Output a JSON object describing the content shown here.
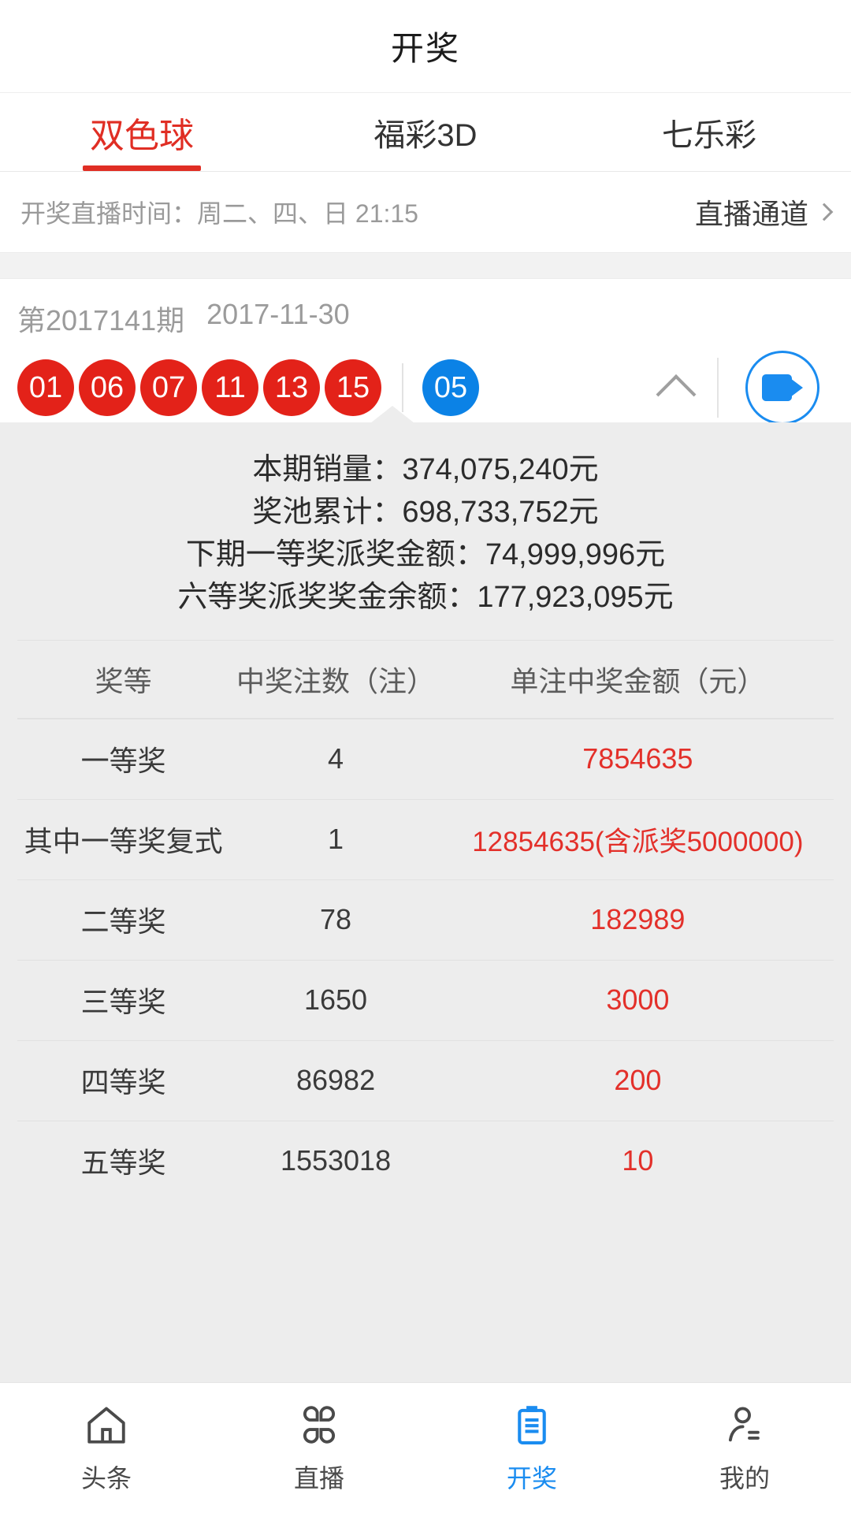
{
  "header": {
    "title": "开奖"
  },
  "tabs": [
    {
      "label": "双色球",
      "active": true
    },
    {
      "label": "福彩3D",
      "active": false
    },
    {
      "label": "七乐彩",
      "active": false
    }
  ],
  "live_bar": {
    "schedule_text": "开奖直播时间：周二、四、日 21:15",
    "channel_label": "直播通道",
    "chevron_icon": "chevron-right-icon"
  },
  "draw": {
    "issue_label": "第2017141期",
    "date": "2017-11-30",
    "red_balls": [
      "01",
      "06",
      "07",
      "11",
      "13",
      "15"
    ],
    "blue_balls": [
      "05"
    ],
    "collapse_icon": "chevron-up-icon",
    "video_icon": "video-camera-icon"
  },
  "stats": [
    "本期销量：374,075,240元",
    "奖池累计：698,733,752元",
    "下期一等奖派奖金额：74,999,996元",
    "六等奖派奖奖金余额：177,923,095元"
  ],
  "prize_table": {
    "columns": [
      "奖等",
      "中奖注数（注）",
      "单注中奖金额（元）"
    ],
    "rows": [
      {
        "level": "一等奖",
        "count": "4",
        "amount": "7854635"
      },
      {
        "level": "其中一等奖复式",
        "count": "1",
        "amount": "12854635(含派奖5000000)"
      },
      {
        "level": "二等奖",
        "count": "78",
        "amount": "182989"
      },
      {
        "level": "三等奖",
        "count": "1650",
        "amount": "3000"
      },
      {
        "level": "四等奖",
        "count": "86982",
        "amount": "200"
      },
      {
        "level": "五等奖",
        "count": "1553018",
        "amount": "10"
      }
    ]
  },
  "bottom_nav": [
    {
      "label": "头条",
      "icon": "home-icon",
      "active": false
    },
    {
      "label": "直播",
      "icon": "grid-petal-icon",
      "active": false
    },
    {
      "label": "开奖",
      "icon": "clipboard-icon",
      "active": true
    },
    {
      "label": "我的",
      "icon": "person-icon",
      "active": false
    }
  ],
  "colors": {
    "accent_red": "#e02e24",
    "accent_blue": "#1a8cf0",
    "red_ball": "#e32219",
    "blue_ball": "#0b82e6",
    "panel_bg": "#ededed"
  }
}
